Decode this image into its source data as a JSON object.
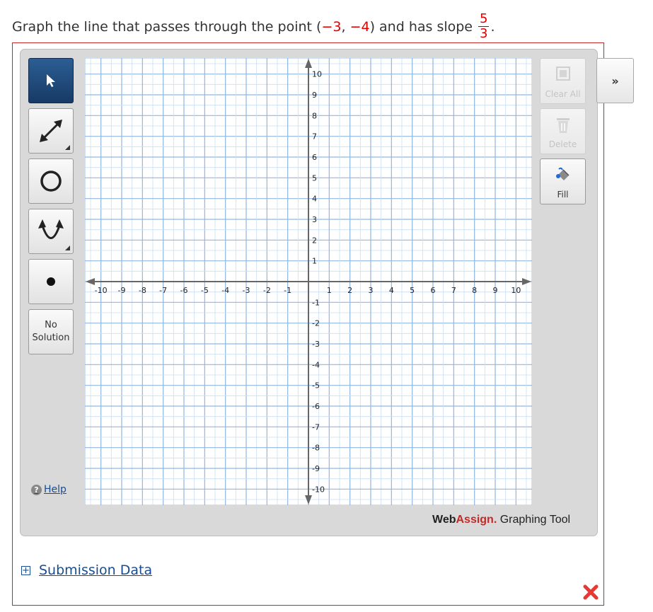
{
  "question": {
    "prefix": "Graph the line that passes through the point (",
    "x": "−3",
    "comma": ", ",
    "y": "−4",
    "middle": ") and has slope ",
    "slope_num": "5",
    "slope_den": "3",
    "suffix": "."
  },
  "left_tools": {
    "pointer": "pointer-tool",
    "line": "line-tool",
    "circle": "circle-tool",
    "parabola": "parabola-tool",
    "point": "point-tool",
    "no_solution_line1": "No",
    "no_solution_line2": "Solution",
    "help": "Help"
  },
  "right_tools": {
    "clear_all": "Clear All",
    "delete": "Delete",
    "fill": "Fill",
    "expand": "»"
  },
  "graph": {
    "x_ticks": [
      "-10",
      "-9",
      "-8",
      "-7",
      "-6",
      "-5",
      "-4",
      "-3",
      "-2",
      "-1",
      "1",
      "2",
      "3",
      "4",
      "5",
      "6",
      "7",
      "8",
      "9",
      "10"
    ],
    "y_ticks": [
      "10",
      "9",
      "8",
      "7",
      "6",
      "5",
      "4",
      "3",
      "2",
      "1",
      "-1",
      "-2",
      "-3",
      "-4",
      "-5",
      "-6",
      "-7",
      "-8",
      "-9",
      "-10"
    ],
    "xlim": [
      -10,
      10
    ],
    "ylim": [
      -10,
      10
    ],
    "grid": true
  },
  "brand": {
    "name_part1": "Web",
    "name_part2": "Assign.",
    "tagline": " Graphing Tool"
  },
  "submission": {
    "label": "Submission Data"
  },
  "colors": {
    "accent_red": "#e00000",
    "grid_blue": "#9fc3ea",
    "link_blue": "#1a4d8f"
  },
  "status_icon": "incorrect-x-icon"
}
